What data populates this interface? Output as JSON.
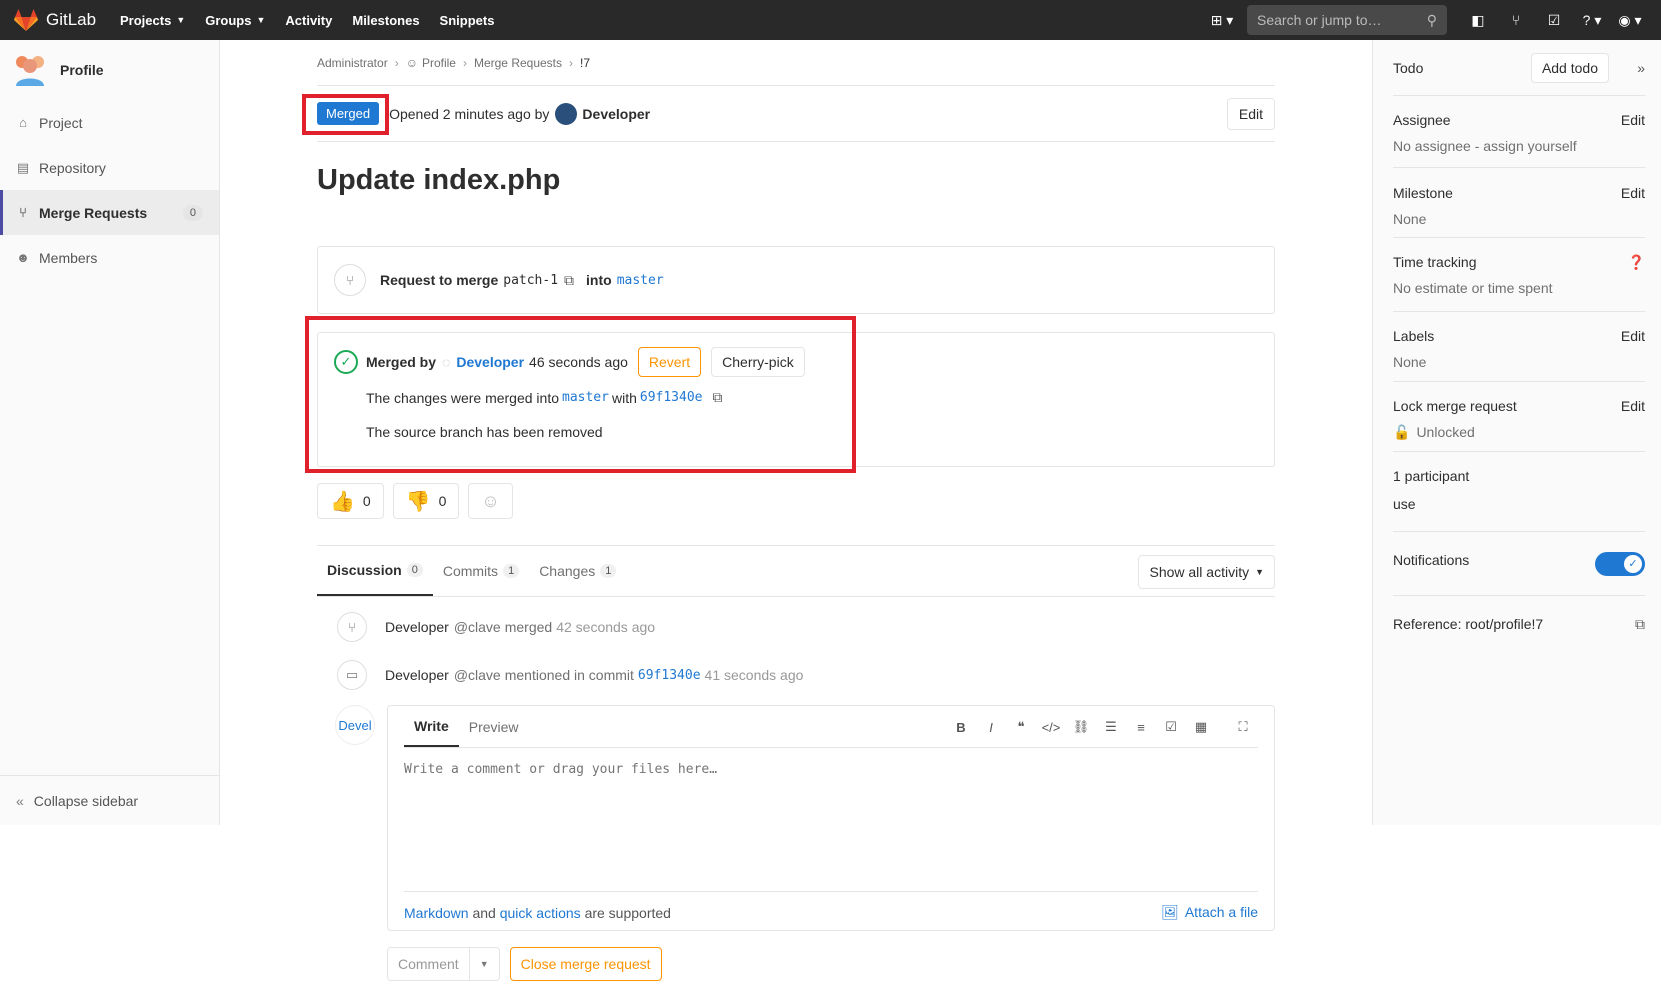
{
  "navbar": {
    "brand": "GitLab",
    "links": [
      "Projects",
      "Groups",
      "Activity",
      "Milestones",
      "Snippets"
    ],
    "search_placeholder": "Search or jump to…"
  },
  "sidebar": {
    "project_name": "Profile",
    "items": [
      {
        "label": "Project",
        "icon": "home-icon"
      },
      {
        "label": "Repository",
        "icon": "book-icon"
      },
      {
        "label": "Merge Requests",
        "icon": "merge-request-icon",
        "count": "0"
      },
      {
        "label": "Members",
        "icon": "users-icon"
      }
    ],
    "collapse_label": "Collapse sidebar"
  },
  "breadcrumb": [
    "Administrator",
    "Profile",
    "Merge Requests",
    "!7"
  ],
  "mr": {
    "status": "Merged",
    "opened_text": "Opened 2 minutes ago by",
    "author": "Developer",
    "edit_label": "Edit",
    "title": "Update index.php",
    "request_prefix": "Request to merge",
    "source_branch": "patch-1",
    "into_label": "into",
    "target_branch": "master",
    "merged_by_label": "Merged by",
    "merged_by_user": "Developer",
    "merged_time": "46 seconds ago",
    "revert_label": "Revert",
    "cherry_pick_label": "Cherry-pick",
    "changes_merged_prefix": "The changes were merged into",
    "changes_merged_branch": "master",
    "with_label": "with",
    "commit_sha": "69f1340e",
    "source_removed": "The source branch has been removed"
  },
  "awards": [
    {
      "emoji": "👍",
      "count": "0"
    },
    {
      "emoji": "👎",
      "count": "0"
    }
  ],
  "tabs": [
    {
      "label": "Discussion",
      "count": "0"
    },
    {
      "label": "Commits",
      "count": "1"
    },
    {
      "label": "Changes",
      "count": "1"
    }
  ],
  "activity_filter": "Show all activity",
  "notes": [
    {
      "user": "Developer",
      "handle": "@clave",
      "action": "merged",
      "time": "42 seconds ago"
    },
    {
      "user": "Developer",
      "handle": "@clave",
      "action": "mentioned in commit",
      "sha": "69f1340e",
      "time": "41 seconds ago"
    }
  ],
  "comment": {
    "avatar_text": "Devel",
    "write_tab": "Write",
    "preview_tab": "Preview",
    "placeholder": "Write a comment or drag your files here…",
    "markdown_link": "Markdown",
    "and": "and",
    "quick_actions_link": "quick actions",
    "supported": "are supported",
    "attach_label": "Attach a file",
    "comment_button": "Comment",
    "close_button": "Close merge request"
  },
  "right_sidebar": {
    "todo_label": "Todo",
    "add_todo": "Add todo",
    "assignee_title": "Assignee",
    "assignee_value": "No assignee - assign yourself",
    "milestone_title": "Milestone",
    "milestone_value": "None",
    "time_tracking_title": "Time tracking",
    "time_tracking_value": "No estimate or time spent",
    "labels_title": "Labels",
    "labels_value": "None",
    "lock_title": "Lock merge request",
    "lock_value": "Unlocked",
    "participants_title": "1 participant",
    "participant_name": "use",
    "notifications_title": "Notifications",
    "reference": "Reference: root/profile!7",
    "edit_label": "Edit"
  },
  "colors": {
    "accent": "#1f78d1",
    "success": "#1aaa55",
    "warning": "#fc9403",
    "highlight": "#e0202a",
    "navbar": "#292929"
  }
}
